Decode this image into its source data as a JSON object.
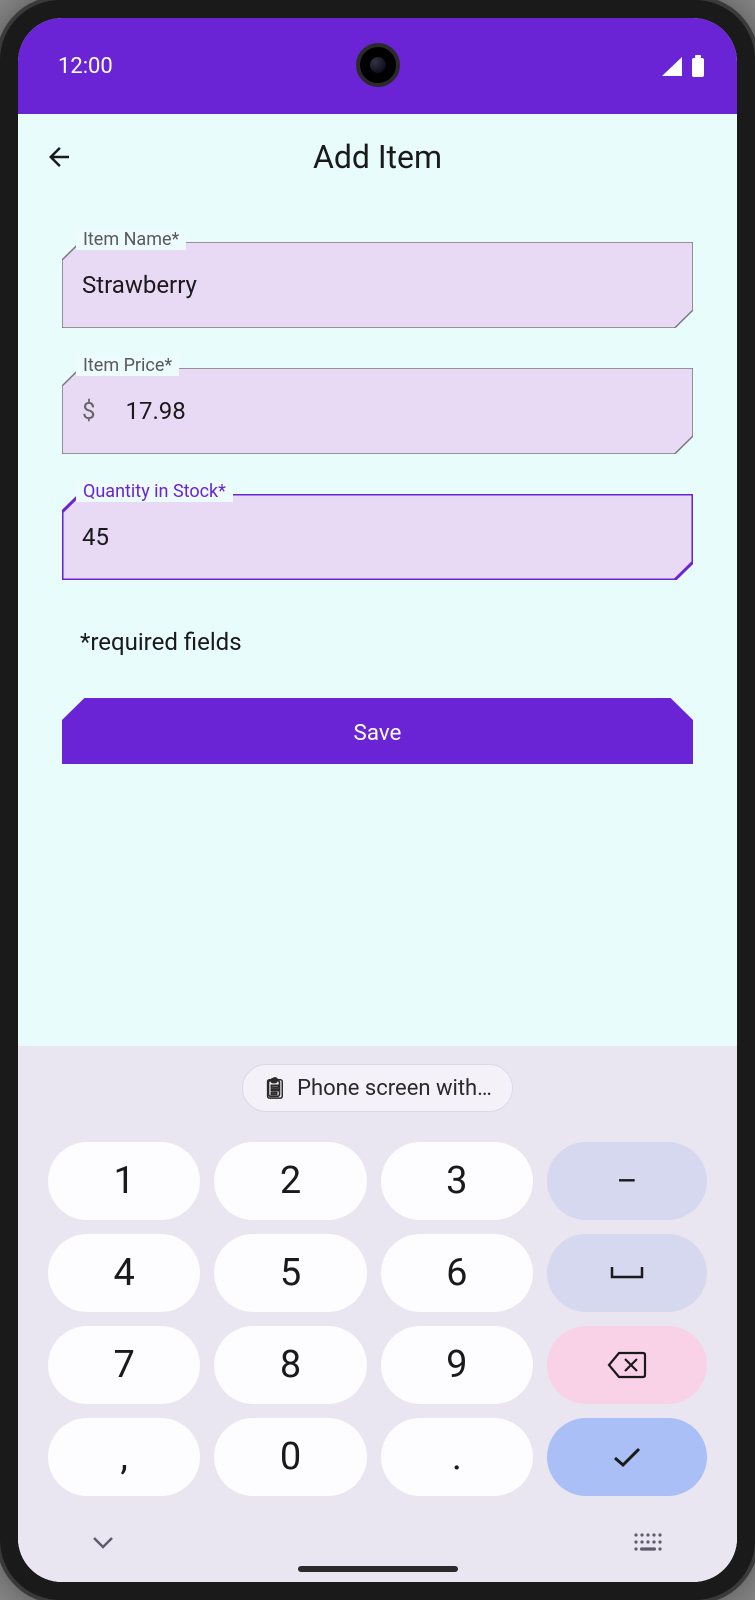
{
  "statusBar": {
    "time": "12:00"
  },
  "appBar": {
    "title": "Add Item"
  },
  "form": {
    "itemName": {
      "label": "Item Name*",
      "value": "Strawberry"
    },
    "itemPrice": {
      "label": "Item Price*",
      "prefix": "$",
      "value": "17.98"
    },
    "quantity": {
      "label": "Quantity in Stock*",
      "value": "45"
    },
    "requiredNote": "*required fields",
    "saveLabel": "Save"
  },
  "keyboard": {
    "suggestion": "Phone screen with…",
    "keys": {
      "r1": [
        "1",
        "2",
        "3"
      ],
      "r2": [
        "4",
        "5",
        "6"
      ],
      "r3": [
        "7",
        "8",
        "9"
      ],
      "r4": [
        ",",
        "0",
        "."
      ]
    },
    "fn": {
      "minus": "–",
      "space": "⌴"
    }
  },
  "colors": {
    "primary": "#6a24d6",
    "fieldFill": "#e8d9f5",
    "appBg": "#e8fcfc",
    "keyboardBg": "#e9e6f1"
  }
}
